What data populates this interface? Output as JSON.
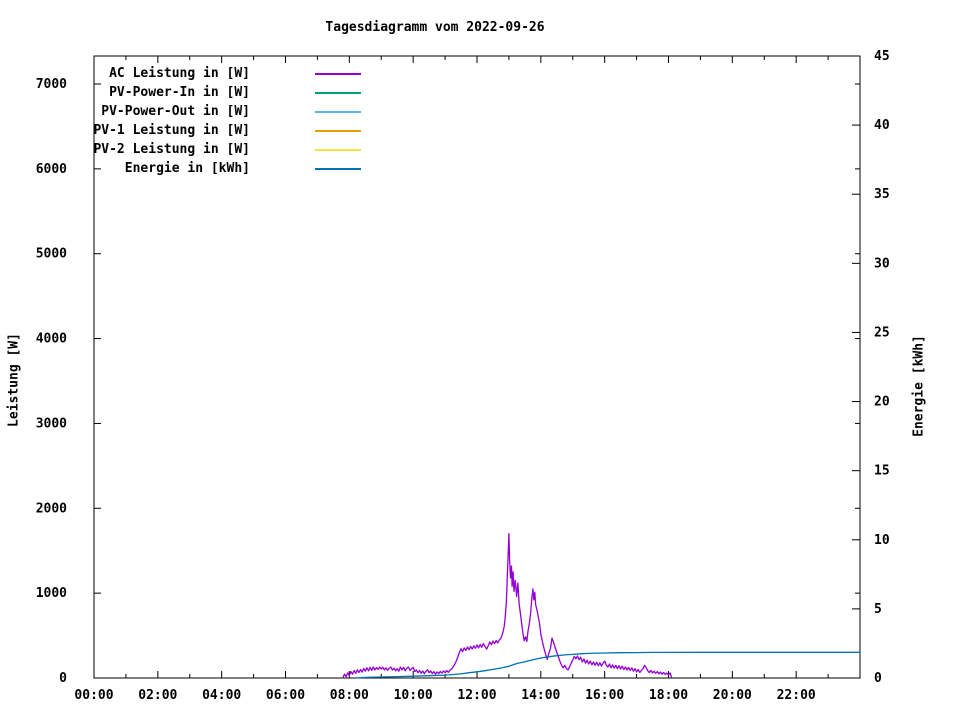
{
  "chart_data": {
    "type": "line",
    "title": "Tagesdiagramm vom 2022-09-26",
    "grid": false,
    "legend_position": "top-left-inside",
    "x_axis": {
      "unit": "time (HH:MM)",
      "range_hours": [
        0,
        24
      ],
      "major_tick_every_hours": 2,
      "minor_tick_every_hours": 1,
      "tick_labels": [
        "00:00",
        "02:00",
        "04:00",
        "06:00",
        "08:00",
        "10:00",
        "12:00",
        "14:00",
        "16:00",
        "18:00",
        "20:00",
        "22:00"
      ]
    },
    "y_axis": {
      "label": "Leistung [W]",
      "range": [
        0,
        7330
      ],
      "ticks": [
        0,
        1000,
        2000,
        3000,
        4000,
        5000,
        6000,
        7000
      ]
    },
    "y2_axis": {
      "label": "Energie [kWh]",
      "range": [
        0,
        45
      ],
      "ticks": [
        0,
        5,
        10,
        15,
        20,
        25,
        30,
        35,
        40,
        45
      ]
    },
    "series": [
      {
        "name": "AC Leistung in [W]",
        "color": "#9400D3",
        "axis": "y",
        "points": [
          [
            7.8,
            8
          ],
          [
            7.85,
            45
          ],
          [
            7.9,
            15
          ],
          [
            7.95,
            60
          ],
          [
            8.0,
            30
          ],
          [
            8.05,
            75
          ],
          [
            8.1,
            45
          ],
          [
            8.15,
            88
          ],
          [
            8.2,
            55
          ],
          [
            8.25,
            95
          ],
          [
            8.3,
            65
          ],
          [
            8.35,
            100
          ],
          [
            8.4,
            70
          ],
          [
            8.45,
            112
          ],
          [
            8.5,
            80
          ],
          [
            8.55,
            120
          ],
          [
            8.6,
            85
          ],
          [
            8.65,
            125
          ],
          [
            8.7,
            90
          ],
          [
            8.75,
            130
          ],
          [
            8.8,
            95
          ],
          [
            8.85,
            122
          ],
          [
            8.9,
            100
          ],
          [
            8.95,
            130
          ],
          [
            9.0,
            105
          ],
          [
            9.05,
            126
          ],
          [
            9.1,
            95
          ],
          [
            9.15,
            120
          ],
          [
            9.2,
            90
          ],
          [
            9.25,
            115
          ],
          [
            9.3,
            128
          ],
          [
            9.35,
            95
          ],
          [
            9.4,
            115
          ],
          [
            9.45,
            85
          ],
          [
            9.5,
            110
          ],
          [
            9.55,
            80
          ],
          [
            9.6,
            130
          ],
          [
            9.65,
            95
          ],
          [
            9.7,
            125
          ],
          [
            9.75,
            85
          ],
          [
            9.8,
            115
          ],
          [
            9.85,
            130
          ],
          [
            9.9,
            90
          ],
          [
            9.95,
            110
          ],
          [
            10.0,
            125
          ],
          [
            10.05,
            75
          ],
          [
            10.1,
            95
          ],
          [
            10.15,
            62
          ],
          [
            10.2,
            88
          ],
          [
            10.25,
            55
          ],
          [
            10.3,
            82
          ],
          [
            10.35,
            52
          ],
          [
            10.4,
            78
          ],
          [
            10.45,
            98
          ],
          [
            10.5,
            62
          ],
          [
            10.55,
            82
          ],
          [
            10.6,
            52
          ],
          [
            10.65,
            76
          ],
          [
            10.7,
            46
          ],
          [
            10.75,
            72
          ],
          [
            10.8,
            52
          ],
          [
            10.85,
            78
          ],
          [
            10.9,
            58
          ],
          [
            10.95,
            82
          ],
          [
            11.0,
            62
          ],
          [
            11.05,
            88
          ],
          [
            11.1,
            66
          ],
          [
            11.15,
            92
          ],
          [
            11.2,
            105
          ],
          [
            11.25,
            130
          ],
          [
            11.3,
            160
          ],
          [
            11.35,
            200
          ],
          [
            11.4,
            250
          ],
          [
            11.45,
            300
          ],
          [
            11.5,
            345
          ],
          [
            11.55,
            310
          ],
          [
            11.6,
            355
          ],
          [
            11.65,
            325
          ],
          [
            11.7,
            365
          ],
          [
            11.75,
            335
          ],
          [
            11.8,
            372
          ],
          [
            11.85,
            340
          ],
          [
            11.9,
            380
          ],
          [
            11.95,
            350
          ],
          [
            12.0,
            390
          ],
          [
            12.05,
            355
          ],
          [
            12.1,
            395
          ],
          [
            12.15,
            362
          ],
          [
            12.2,
            405
          ],
          [
            12.25,
            372
          ],
          [
            12.3,
            340
          ],
          [
            12.35,
            380
          ],
          [
            12.4,
            425
          ],
          [
            12.45,
            392
          ],
          [
            12.5,
            435
          ],
          [
            12.55,
            405
          ],
          [
            12.6,
            442
          ],
          [
            12.65,
            412
          ],
          [
            12.7,
            448
          ],
          [
            12.75,
            468
          ],
          [
            12.8,
            520
          ],
          [
            12.85,
            600
          ],
          [
            12.88,
            700
          ],
          [
            12.92,
            900
          ],
          [
            12.95,
            1200
          ],
          [
            12.98,
            1500
          ],
          [
            13.0,
            1700
          ],
          [
            13.02,
            1400
          ],
          [
            13.05,
            1180
          ],
          [
            13.08,
            1320
          ],
          [
            13.1,
            1080
          ],
          [
            13.13,
            1250
          ],
          [
            13.16,
            1020
          ],
          [
            13.2,
            1150
          ],
          [
            13.24,
            960
          ],
          [
            13.28,
            1120
          ],
          [
            13.32,
            880
          ],
          [
            13.36,
            760
          ],
          [
            13.4,
            640
          ],
          [
            13.44,
            520
          ],
          [
            13.48,
            440
          ],
          [
            13.52,
            485
          ],
          [
            13.56,
            430
          ],
          [
            13.6,
            560
          ],
          [
            13.64,
            640
          ],
          [
            13.68,
            760
          ],
          [
            13.72,
            950
          ],
          [
            13.75,
            1050
          ],
          [
            13.78,
            920
          ],
          [
            13.81,
            1010
          ],
          [
            13.84,
            860
          ],
          [
            13.88,
            800
          ],
          [
            13.92,
            720
          ],
          [
            13.96,
            640
          ],
          [
            14.0,
            520
          ],
          [
            14.05,
            430
          ],
          [
            14.1,
            350
          ],
          [
            14.15,
            280
          ],
          [
            14.2,
            220
          ],
          [
            14.25,
            290
          ],
          [
            14.3,
            345
          ],
          [
            14.35,
            470
          ],
          [
            14.4,
            420
          ],
          [
            14.45,
            360
          ],
          [
            14.5,
            300
          ],
          [
            14.55,
            250
          ],
          [
            14.6,
            195
          ],
          [
            14.65,
            150
          ],
          [
            14.7,
            120
          ],
          [
            14.75,
            150
          ],
          [
            14.8,
            110
          ],
          [
            14.85,
            95
          ],
          [
            14.9,
            130
          ],
          [
            14.95,
            175
          ],
          [
            15.0,
            215
          ],
          [
            15.05,
            255
          ],
          [
            15.1,
            225
          ],
          [
            15.15,
            260
          ],
          [
            15.2,
            215
          ],
          [
            15.25,
            245
          ],
          [
            15.3,
            190
          ],
          [
            15.35,
            225
          ],
          [
            15.4,
            175
          ],
          [
            15.45,
            210
          ],
          [
            15.5,
            165
          ],
          [
            15.55,
            200
          ],
          [
            15.6,
            155
          ],
          [
            15.65,
            190
          ],
          [
            15.7,
            150
          ],
          [
            15.75,
            185
          ],
          [
            15.8,
            145
          ],
          [
            15.85,
            180
          ],
          [
            15.9,
            140
          ],
          [
            15.95,
            175
          ],
          [
            16.0,
            200
          ],
          [
            16.05,
            150
          ],
          [
            16.1,
            130
          ],
          [
            16.15,
            165
          ],
          [
            16.2,
            120
          ],
          [
            16.25,
            155
          ],
          [
            16.3,
            115
          ],
          [
            16.35,
            150
          ],
          [
            16.4,
            110
          ],
          [
            16.45,
            145
          ],
          [
            16.5,
            105
          ],
          [
            16.55,
            140
          ],
          [
            16.6,
            100
          ],
          [
            16.65,
            130
          ],
          [
            16.7,
            95
          ],
          [
            16.75,
            125
          ],
          [
            16.8,
            90
          ],
          [
            16.85,
            120
          ],
          [
            16.9,
            80
          ],
          [
            16.95,
            110
          ],
          [
            17.0,
            72
          ],
          [
            17.05,
            100
          ],
          [
            17.1,
            65
          ],
          [
            17.15,
            90
          ],
          [
            17.2,
            110
          ],
          [
            17.25,
            150
          ],
          [
            17.3,
            120
          ],
          [
            17.35,
            85
          ],
          [
            17.4,
            65
          ],
          [
            17.45,
            90
          ],
          [
            17.5,
            60
          ],
          [
            17.55,
            80
          ],
          [
            17.6,
            55
          ],
          [
            17.65,
            75
          ],
          [
            17.7,
            50
          ],
          [
            17.75,
            70
          ],
          [
            17.8,
            45
          ],
          [
            17.85,
            65
          ],
          [
            17.9,
            42
          ],
          [
            17.95,
            58
          ],
          [
            18.0,
            38
          ],
          [
            18.05,
            60
          ],
          [
            18.08,
            25
          ],
          [
            18.1,
            0
          ]
        ]
      },
      {
        "name": "PV-Power-In in [W]",
        "color": "#009E73",
        "axis": "y",
        "points": []
      },
      {
        "name": "PV-Power-Out in [W]",
        "color": "#56B4E9",
        "axis": "y",
        "points": []
      },
      {
        "name": "PV-1 Leistung in [W]",
        "color": "#E69F00",
        "axis": "y",
        "points": []
      },
      {
        "name": "PV-2 Leistung in [W]",
        "color": "#F0E442",
        "axis": "y",
        "points": []
      },
      {
        "name": "Energie in [kWh]",
        "color": "#0072B2",
        "axis": "y2",
        "points": [
          [
            8.2,
            0.01
          ],
          [
            8.5,
            0.04
          ],
          [
            9.0,
            0.07
          ],
          [
            9.5,
            0.1
          ],
          [
            10.0,
            0.13
          ],
          [
            10.5,
            0.17
          ],
          [
            11.0,
            0.21
          ],
          [
            11.25,
            0.25
          ],
          [
            11.5,
            0.3
          ],
          [
            11.75,
            0.38
          ],
          [
            12.0,
            0.45
          ],
          [
            12.25,
            0.53
          ],
          [
            12.5,
            0.62
          ],
          [
            12.75,
            0.72
          ],
          [
            13.0,
            0.85
          ],
          [
            13.25,
            1.05
          ],
          [
            13.5,
            1.18
          ],
          [
            13.75,
            1.32
          ],
          [
            14.0,
            1.45
          ],
          [
            14.25,
            1.54
          ],
          [
            14.5,
            1.61
          ],
          [
            14.75,
            1.67
          ],
          [
            15.0,
            1.71
          ],
          [
            15.25,
            1.75
          ],
          [
            15.5,
            1.78
          ],
          [
            16.0,
            1.81
          ],
          [
            16.5,
            1.83
          ],
          [
            17.0,
            1.84
          ],
          [
            17.5,
            1.85
          ],
          [
            18.0,
            1.85
          ],
          [
            19.0,
            1.86
          ],
          [
            20.0,
            1.86
          ],
          [
            22.0,
            1.86
          ],
          [
            24.0,
            1.86
          ]
        ]
      }
    ]
  }
}
